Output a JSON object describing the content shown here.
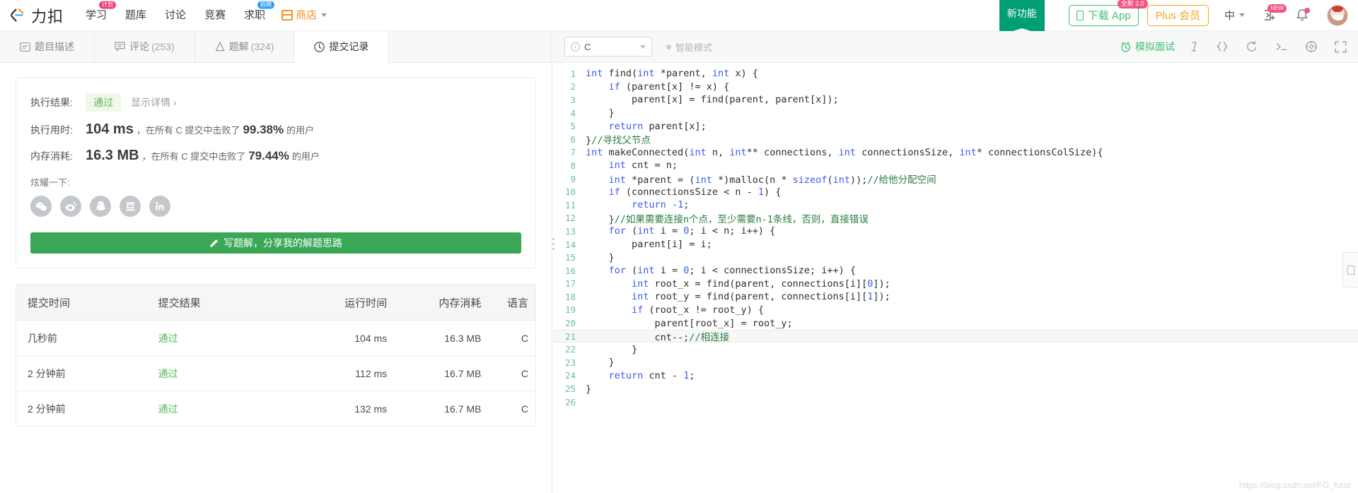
{
  "header": {
    "logo_text": "力扣",
    "nav": [
      {
        "label": "学习",
        "badge": "计划",
        "badge_color": "#eb3d7e"
      },
      {
        "label": "题库",
        "badge": "",
        "badge_color": ""
      },
      {
        "label": "讨论",
        "badge": "",
        "badge_color": ""
      },
      {
        "label": "竞赛",
        "badge": "",
        "badge_color": ""
      },
      {
        "label": "求职",
        "badge": "招聘",
        "badge_color": "#2e9bf0"
      }
    ],
    "shop_label": "商店",
    "ribbon_label": "新功能",
    "download_label": "下载 App",
    "download_badge": "全新 2.0",
    "plus_label": "Plus 会员",
    "lang_label": "中",
    "invite_badge": "NEW"
  },
  "tabs": [
    {
      "label": "题目描述",
      "count": "",
      "icon": "description-icon",
      "active": false
    },
    {
      "label": "评论",
      "count": "(253)",
      "icon": "comment-icon",
      "active": false
    },
    {
      "label": "题解",
      "count": "(324)",
      "icon": "flask-icon",
      "active": false
    },
    {
      "label": "提交记录",
      "count": "",
      "icon": "clock-icon",
      "active": true
    }
  ],
  "result": {
    "status_label": "执行结果:",
    "status_value": "通过",
    "detail_link": "显示详情 ›",
    "runtime_label": "执行用时:",
    "runtime_value": "104 ms",
    "runtime_suffix_a": "，在所有 C 提交中击败了",
    "runtime_percent": "99.38%",
    "runtime_suffix_b": "的用户",
    "memory_label": "内存消耗:",
    "memory_value": "16.3 MB",
    "memory_suffix_a": "，在所有 C 提交中击败了",
    "memory_percent": "79.44%",
    "memory_suffix_b": "的用户",
    "brag_label": "炫耀一下:",
    "socials": [
      "wechat-icon",
      "weibo-icon",
      "qq-icon",
      "douban-icon",
      "linkedin-icon"
    ],
    "write_button": "写题解，分享我的解题思路"
  },
  "submissions": {
    "columns": [
      "提交时间",
      "提交结果",
      "运行时间",
      "内存消耗",
      "语言"
    ],
    "rows": [
      {
        "time": "几秒前",
        "result": "通过",
        "runtime": "104 ms",
        "memory": "16.3 MB",
        "lang": "C"
      },
      {
        "time": "2 分钟前",
        "result": "通过",
        "runtime": "112 ms",
        "memory": "16.7 MB",
        "lang": "C"
      },
      {
        "time": "2 分钟前",
        "result": "通过",
        "runtime": "132 ms",
        "memory": "16.7 MB",
        "lang": "C"
      }
    ]
  },
  "editor": {
    "language": "C",
    "smart_mode": "智能模式",
    "mock_interview": "模拟面试",
    "watermark": "https://blog.csdn.net/FG_futur",
    "highlight_line": 21,
    "lines": [
      {
        "n": 1,
        "tokens": [
          {
            "t": "int",
            "c": "kw"
          },
          {
            "t": " find(",
            "c": ""
          },
          {
            "t": "int",
            "c": "kw"
          },
          {
            "t": " *parent, ",
            "c": ""
          },
          {
            "t": "int",
            "c": "kw"
          },
          {
            "t": " x) {",
            "c": ""
          }
        ]
      },
      {
        "n": 2,
        "tokens": [
          {
            "t": "    ",
            "c": ""
          },
          {
            "t": "if",
            "c": "kw"
          },
          {
            "t": " (parent[x] != x) {",
            "c": ""
          }
        ]
      },
      {
        "n": 3,
        "tokens": [
          {
            "t": "        parent[x] = find(parent, parent[x]);",
            "c": ""
          }
        ]
      },
      {
        "n": 4,
        "tokens": [
          {
            "t": "    }",
            "c": ""
          }
        ]
      },
      {
        "n": 5,
        "tokens": [
          {
            "t": "    ",
            "c": ""
          },
          {
            "t": "return",
            "c": "kw"
          },
          {
            "t": " parent[x];",
            "c": ""
          }
        ]
      },
      {
        "n": 6,
        "tokens": [
          {
            "t": "}",
            "c": ""
          },
          {
            "t": "//寻找父节点",
            "c": "cm"
          }
        ]
      },
      {
        "n": 7,
        "tokens": [
          {
            "t": "int",
            "c": "kw"
          },
          {
            "t": " makeConnected(",
            "c": ""
          },
          {
            "t": "int",
            "c": "kw"
          },
          {
            "t": " n, ",
            "c": ""
          },
          {
            "t": "int",
            "c": "kw"
          },
          {
            "t": "** connections, ",
            "c": ""
          },
          {
            "t": "int",
            "c": "kw"
          },
          {
            "t": " connectionsSize, ",
            "c": ""
          },
          {
            "t": "int",
            "c": "kw"
          },
          {
            "t": "* connectionsColSize){",
            "c": ""
          }
        ]
      },
      {
        "n": 8,
        "tokens": [
          {
            "t": "    ",
            "c": ""
          },
          {
            "t": "int",
            "c": "kw"
          },
          {
            "t": " cnt = n;",
            "c": ""
          }
        ]
      },
      {
        "n": 9,
        "tokens": [
          {
            "t": "    ",
            "c": ""
          },
          {
            "t": "int",
            "c": "kw"
          },
          {
            "t": " *parent = (",
            "c": ""
          },
          {
            "t": "int",
            "c": "kw"
          },
          {
            "t": " *)malloc(n * ",
            "c": ""
          },
          {
            "t": "sizeof",
            "c": "kw"
          },
          {
            "t": "(",
            "c": ""
          },
          {
            "t": "int",
            "c": "kw"
          },
          {
            "t": "));",
            "c": ""
          },
          {
            "t": "//给他分配空间",
            "c": "cm"
          }
        ]
      },
      {
        "n": 10,
        "tokens": [
          {
            "t": "    ",
            "c": ""
          },
          {
            "t": "if",
            "c": "kw"
          },
          {
            "t": " (connectionsSize < n - ",
            "c": ""
          },
          {
            "t": "1",
            "c": "kw"
          },
          {
            "t": ") {",
            "c": ""
          }
        ]
      },
      {
        "n": 11,
        "tokens": [
          {
            "t": "        ",
            "c": ""
          },
          {
            "t": "return",
            "c": "kw"
          },
          {
            "t": " ",
            "c": ""
          },
          {
            "t": "-1",
            "c": "kw"
          },
          {
            "t": ";",
            "c": ""
          }
        ]
      },
      {
        "n": 12,
        "tokens": [
          {
            "t": "    }",
            "c": ""
          },
          {
            "t": "//如果需要连接n个点，至少需要n-1条线，否则，直接错误",
            "c": "cm"
          }
        ]
      },
      {
        "n": 13,
        "tokens": [
          {
            "t": "    ",
            "c": ""
          },
          {
            "t": "for",
            "c": "kw"
          },
          {
            "t": " (",
            "c": ""
          },
          {
            "t": "int",
            "c": "kw"
          },
          {
            "t": " i = ",
            "c": ""
          },
          {
            "t": "0",
            "c": "kw"
          },
          {
            "t": "; i < n; i++) {",
            "c": ""
          }
        ]
      },
      {
        "n": 14,
        "tokens": [
          {
            "t": "        parent[i] = i;",
            "c": ""
          }
        ]
      },
      {
        "n": 15,
        "tokens": [
          {
            "t": "    }",
            "c": ""
          }
        ]
      },
      {
        "n": 16,
        "tokens": [
          {
            "t": "    ",
            "c": ""
          },
          {
            "t": "for",
            "c": "kw"
          },
          {
            "t": " (",
            "c": ""
          },
          {
            "t": "int",
            "c": "kw"
          },
          {
            "t": " i = ",
            "c": ""
          },
          {
            "t": "0",
            "c": "kw"
          },
          {
            "t": "; i < connectionsSize; i++) {",
            "c": ""
          }
        ]
      },
      {
        "n": 17,
        "tokens": [
          {
            "t": "        ",
            "c": ""
          },
          {
            "t": "int",
            "c": "kw"
          },
          {
            "t": " root_x = find(parent, connections[i][",
            "c": ""
          },
          {
            "t": "0",
            "c": "kw"
          },
          {
            "t": "]);",
            "c": ""
          }
        ]
      },
      {
        "n": 18,
        "tokens": [
          {
            "t": "        ",
            "c": ""
          },
          {
            "t": "int",
            "c": "kw"
          },
          {
            "t": " root_y = find(parent, connections[i][",
            "c": ""
          },
          {
            "t": "1",
            "c": "kw"
          },
          {
            "t": "]);",
            "c": ""
          }
        ]
      },
      {
        "n": 19,
        "tokens": [
          {
            "t": "        ",
            "c": ""
          },
          {
            "t": "if",
            "c": "kw"
          },
          {
            "t": " (root_x != root_y) {",
            "c": ""
          }
        ]
      },
      {
        "n": 20,
        "tokens": [
          {
            "t": "            parent[root_x] = root_y;",
            "c": ""
          }
        ]
      },
      {
        "n": 21,
        "tokens": [
          {
            "t": "            cnt--;",
            "c": ""
          },
          {
            "t": "//相连接",
            "c": "cm"
          }
        ]
      },
      {
        "n": 22,
        "tokens": [
          {
            "t": "        }",
            "c": ""
          }
        ]
      },
      {
        "n": 23,
        "tokens": [
          {
            "t": "    }",
            "c": ""
          }
        ]
      },
      {
        "n": 24,
        "tokens": [
          {
            "t": "    ",
            "c": ""
          },
          {
            "t": "return",
            "c": "kw"
          },
          {
            "t": " cnt - ",
            "c": ""
          },
          {
            "t": "1",
            "c": "kw"
          },
          {
            "t": ";",
            "c": ""
          }
        ]
      },
      {
        "n": 25,
        "tokens": [
          {
            "t": "}",
            "c": ""
          }
        ]
      },
      {
        "n": 26,
        "tokens": [
          {
            "t": "",
            "c": ""
          }
        ]
      }
    ]
  }
}
